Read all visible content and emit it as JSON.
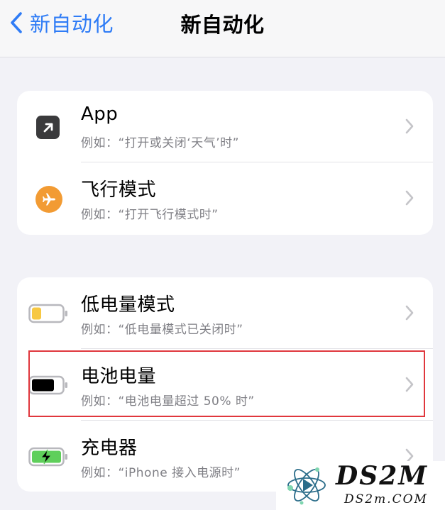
{
  "nav": {
    "back_label": "新自动化",
    "title": "新自动化"
  },
  "groups": [
    {
      "rows": [
        {
          "title": "App",
          "subtitle": "例如：“打开或关闭‘天气’时”",
          "icon": "app-icon"
        },
        {
          "title": "飞行模式",
          "subtitle": "例如：“打开飞行模式时”",
          "icon": "airplane-icon"
        }
      ]
    },
    {
      "rows": [
        {
          "title": "低电量模式",
          "subtitle": "例如：“低电量模式已关闭时”",
          "icon": "low-power-battery-icon"
        },
        {
          "title": "电池电量",
          "subtitle": "例如：“电池电量超过 50% 时”",
          "icon": "battery-level-icon",
          "highlighted": true
        },
        {
          "title": "充电器",
          "subtitle": "例如：“iPhone 接入电源时”",
          "icon": "charging-battery-icon"
        }
      ]
    }
  ],
  "watermark": {
    "title": "DS2M",
    "subtitle": "DS2m.COM"
  },
  "colors": {
    "accent": "#2f7cf6",
    "app_icon_bg": "#3a3a3c",
    "airplane_icon_bg": "#f29b33",
    "low_power_fill": "#f7c843",
    "charging_fill": "#5fcf5b",
    "highlight_border": "#e0373d"
  }
}
